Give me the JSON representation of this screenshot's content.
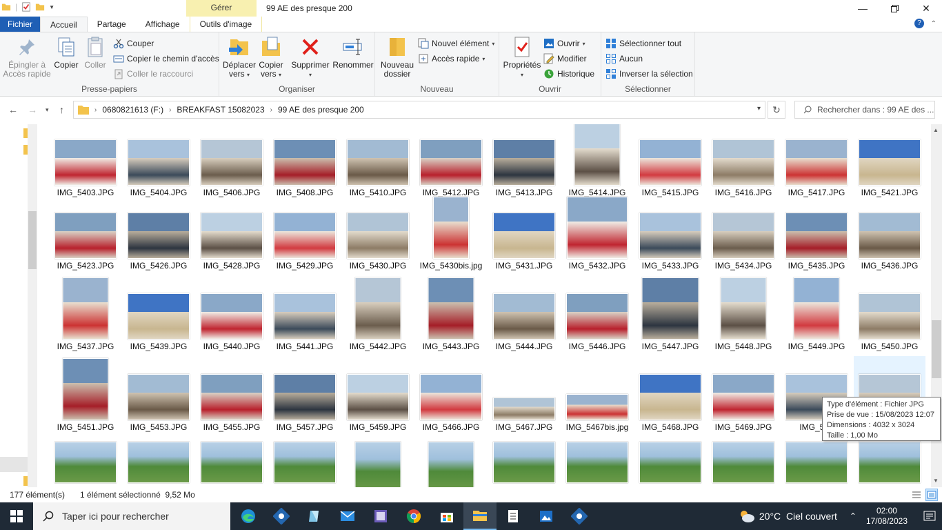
{
  "titlebar": {
    "context_tab_header": "Gérer",
    "window_title": "99 AE des presque 200"
  },
  "ribbon_tabs": [
    "Fichier",
    "Accueil",
    "Partage",
    "Affichage",
    "Outils d'image"
  ],
  "ribbon": {
    "presse_papiers": {
      "label": "Presse-papiers",
      "pin": "Épingler à Accès rapide",
      "copier": "Copier",
      "coller": "Coller",
      "couper": "Couper",
      "copier_chemin": "Copier le chemin d'accès",
      "coller_raccourci": "Coller le raccourci"
    },
    "organiser": {
      "label": "Organiser",
      "deplacer": "Déplacer vers",
      "copier_vers": "Copier vers",
      "supprimer": "Supprimer",
      "renommer": "Renommer"
    },
    "nouveau": {
      "label": "Nouveau",
      "nouveau_dossier": "Nouveau dossier",
      "nouvel_element": "Nouvel élément",
      "acces_rapide": "Accès rapide"
    },
    "ouvrir": {
      "label": "Ouvrir",
      "proprietes": "Propriétés",
      "ouvrir": "Ouvrir",
      "modifier": "Modifier",
      "historique": "Historique"
    },
    "selectionner": {
      "label": "Sélectionner",
      "tout": "Sélectionner tout",
      "aucun": "Aucun",
      "inverser": "Inverser la sélection"
    }
  },
  "address": {
    "crumbs": [
      "0680821613 (F:)",
      "BREAKFAST 15082023",
      "99 AE des presque 200"
    ],
    "search_placeholder": "Rechercher dans : 99 AE des ..."
  },
  "files": [
    "IMG_5403.JPG",
    "IMG_5404.JPG",
    "IMG_5406.JPG",
    "IMG_5408.JPG",
    "IMG_5410.JPG",
    "IMG_5412.JPG",
    "IMG_5413.JPG",
    "IMG_5414.JPG",
    "IMG_5415.JPG",
    "IMG_5416.JPG",
    "IMG_5417.JPG",
    "IMG_5421.JPG",
    "IMG_5423.JPG",
    "IMG_5426.JPG",
    "IMG_5428.JPG",
    "IMG_5429.JPG",
    "IMG_5430.JPG",
    "IMG_5430bis.jpg",
    "IMG_5431.JPG",
    "IMG_5432.JPG",
    "IMG_5433.JPG",
    "IMG_5434.JPG",
    "IMG_5435.JPG",
    "IMG_5436.JPG",
    "IMG_5437.JPG",
    "IMG_5439.JPG",
    "IMG_5440.JPG",
    "IMG_5441.JPG",
    "IMG_5442.JPG",
    "IMG_5443.JPG",
    "IMG_5444.JPG",
    "IMG_5446.JPG",
    "IMG_5447.JPG",
    "IMG_5448.JPG",
    "IMG_5449.JPG",
    "IMG_5450.JPG",
    "IMG_5451.JPG",
    "IMG_5453.JPG",
    "IMG_5455.JPG",
    "IMG_5457.JPG",
    "IMG_5459.JPG",
    "IMG_5466.JPG",
    "IMG_5467.JPG",
    "IMG_5467bis.jpg",
    "IMG_5468.JPG",
    "IMG_5469.JPG",
    "IMG_547",
    ""
  ],
  "tooltip": {
    "type": "Type d'élément : Fichier JPG",
    "date": "Prise de vue : 15/08/2023 12:07",
    "dimensions": "Dimensions : 4032 x 3024",
    "size": "Taille : 1,00 Mo"
  },
  "status": {
    "count": "177 élément(s)",
    "selected": "1 élément sélectionné  9,52 Mo"
  },
  "taskbar": {
    "search_placeholder": "Taper ici pour rechercher",
    "weather": "20°C  Ciel couvert",
    "time": "02:00",
    "date": "17/08/2023"
  }
}
